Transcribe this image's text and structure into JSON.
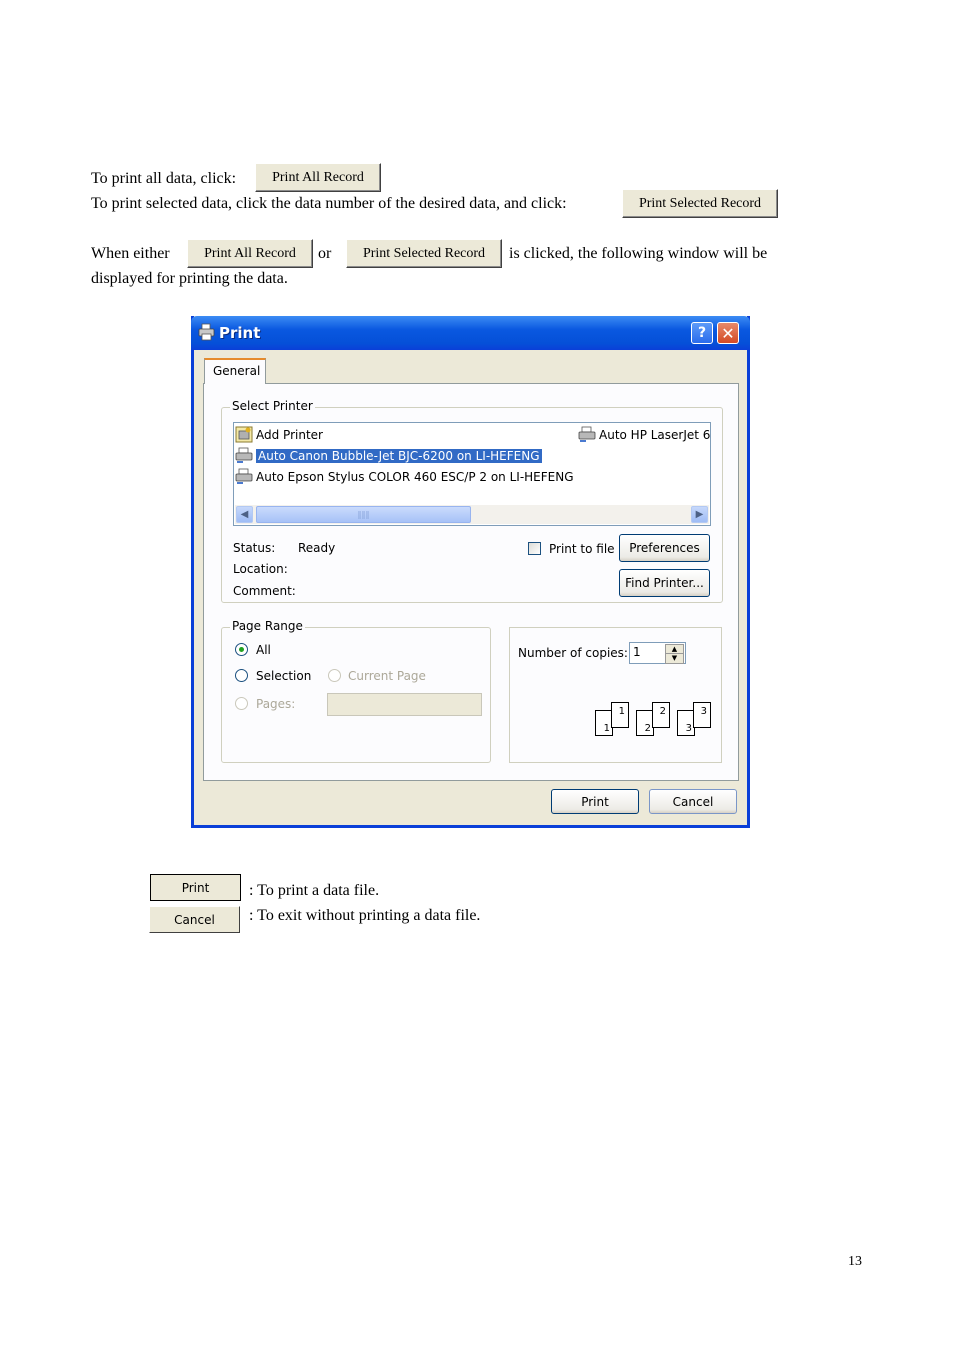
{
  "intro": {
    "line1_text": "To print all data, click:",
    "line2_text": "To print selected data, click the data number of the desired data, and click:",
    "line3_start": "When either",
    "line3_or": "or",
    "line3_end": "is clicked, the following window will be",
    "line4_text": "displayed for printing the data.",
    "print_all_label": "Print All Record",
    "print_selected_label": "Print Selected Record"
  },
  "dialog": {
    "title": "Print",
    "help_glyph": "?",
    "close_glyph": "✕",
    "tab_label": "General",
    "select_printer": {
      "label": "Select Printer",
      "items": [
        {
          "name": "Add Printer",
          "icon": "add-printer-icon"
        },
        {
          "name": "Auto HP LaserJet 6",
          "icon": "printer-icon"
        },
        {
          "name": "Auto Canon Bubble-Jet BJC-6200 on LI-HEFENG",
          "icon": "printer-icon",
          "selected": true
        },
        {
          "name": "Auto Epson Stylus COLOR 460 ESC/P 2 on LI-HEFENG",
          "icon": "printer-icon"
        }
      ],
      "status_label": "Status:",
      "status_value": "Ready",
      "location_label": "Location:",
      "comment_label": "Comment:",
      "print_to_file_label": "Print to file",
      "preferences_label": "Preferences",
      "find_printer_label": "Find Printer..."
    },
    "page_range": {
      "label": "Page Range",
      "all_label": "All",
      "selection_label": "Selection",
      "current_page_label": "Current Page",
      "pages_label": "Pages:"
    },
    "copies": {
      "label": "Number of copies:",
      "value": "1",
      "collate_pages": [
        "1",
        "1",
        "2",
        "2",
        "3",
        "3"
      ]
    },
    "print_label": "Print",
    "cancel_label": "Cancel"
  },
  "legend": {
    "print_button_label": "Print",
    "print_desc": ": To print a data file.",
    "cancel_button_label": "Cancel",
    "cancel_desc": ": To exit without printing a data file."
  },
  "page_number": "13"
}
